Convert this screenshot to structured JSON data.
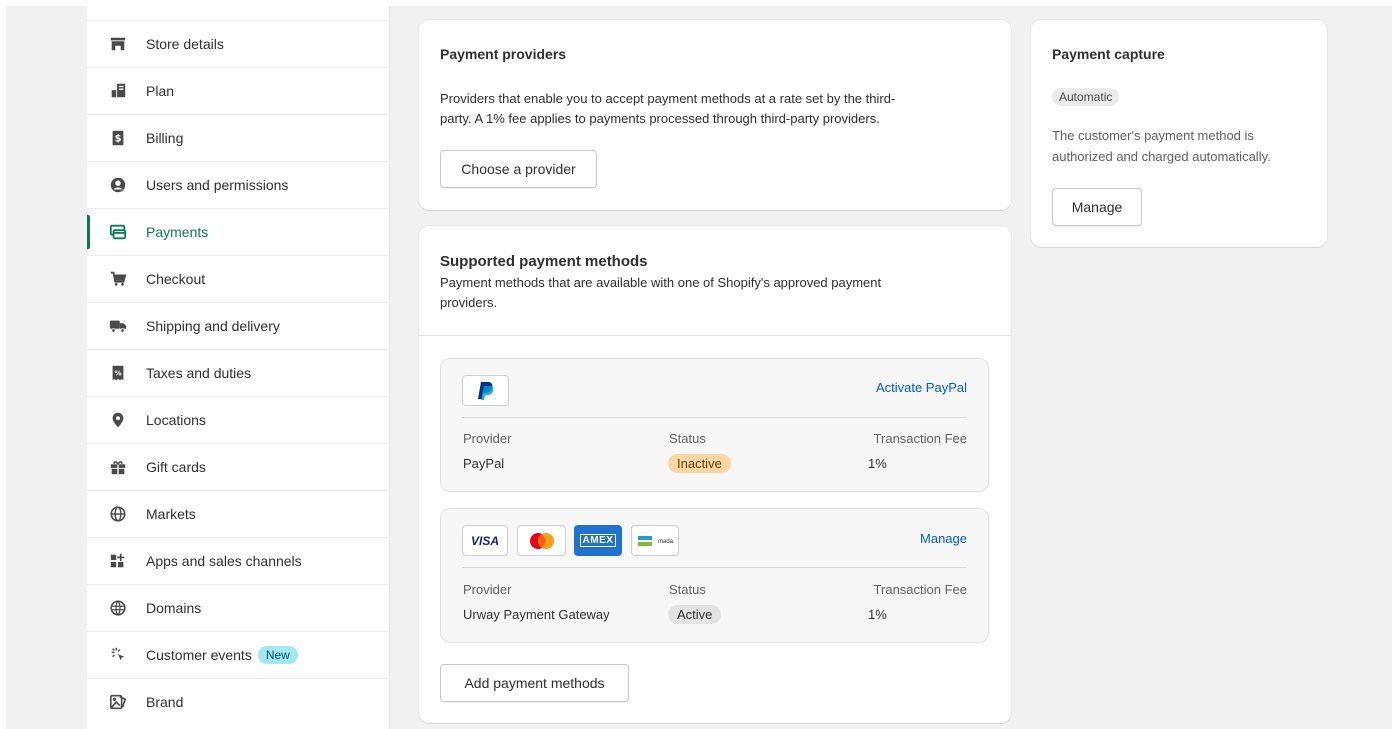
{
  "sidebar": {
    "items": [
      {
        "label": "Store details",
        "icon": "store-icon"
      },
      {
        "label": "Plan",
        "icon": "plan-icon"
      },
      {
        "label": "Billing",
        "icon": "billing-icon"
      },
      {
        "label": "Users and permissions",
        "icon": "user-icon"
      },
      {
        "label": "Payments",
        "icon": "payments-icon",
        "active": true
      },
      {
        "label": "Checkout",
        "icon": "cart-icon"
      },
      {
        "label": "Shipping and delivery",
        "icon": "truck-icon"
      },
      {
        "label": "Taxes and duties",
        "icon": "tax-icon"
      },
      {
        "label": "Locations",
        "icon": "location-pin-icon"
      },
      {
        "label": "Gift cards",
        "icon": "gift-icon"
      },
      {
        "label": "Markets",
        "icon": "globe-icon"
      },
      {
        "label": "Apps and sales channels",
        "icon": "apps-icon"
      },
      {
        "label": "Domains",
        "icon": "domain-globe-icon"
      },
      {
        "label": "Customer events",
        "icon": "sparkle-cursor-icon",
        "badge": "New"
      },
      {
        "label": "Brand",
        "icon": "brand-icon"
      }
    ]
  },
  "providers": {
    "title": "Payment providers",
    "description": "Providers that enable you to accept payment methods at a rate set by the third-party. A 1% fee applies to payments processed through third-party providers.",
    "description_line1": "Providers that enable you to accept payment methods at a rate set by the third-",
    "description_line2": "party. A 1% fee applies to payments processed through third-party providers.",
    "button": "Choose a provider"
  },
  "supported": {
    "title": "Supported payment methods",
    "description_line1": "Payment methods that are available with one of Shopify's approved payment",
    "description_line2": "providers.",
    "methods": [
      {
        "action": "Activate PayPal",
        "provider_label": "Provider",
        "provider": "PayPal",
        "status_label": "Status",
        "status": "Inactive",
        "fee_label": "Transaction Fee",
        "fee": "1%",
        "logos": [
          "paypal-logo"
        ]
      },
      {
        "action": "Manage",
        "provider_label": "Provider",
        "provider": "Urway Payment Gateway",
        "status_label": "Status",
        "status": "Active",
        "fee_label": "Transaction Fee",
        "fee": "1%",
        "logos": [
          "visa-logo",
          "mastercard-logo",
          "amex-logo",
          "mada-logo"
        ],
        "visa_text": "VISA",
        "amex_text": "AMEX",
        "mada_text": "mada"
      }
    ],
    "add_button": "Add payment methods"
  },
  "capture": {
    "title": "Payment capture",
    "badge": "Automatic",
    "description_line1": "The customer's payment method is",
    "description_line2": "authorized and charged automatically.",
    "button": "Manage"
  },
  "colors": {
    "accent": "#0a7a55",
    "link": "#005bd3",
    "inactive_bg": "#ffd6a4",
    "active_bg": "#e3e3e3",
    "new_badge_bg": "#a4e8f2"
  }
}
